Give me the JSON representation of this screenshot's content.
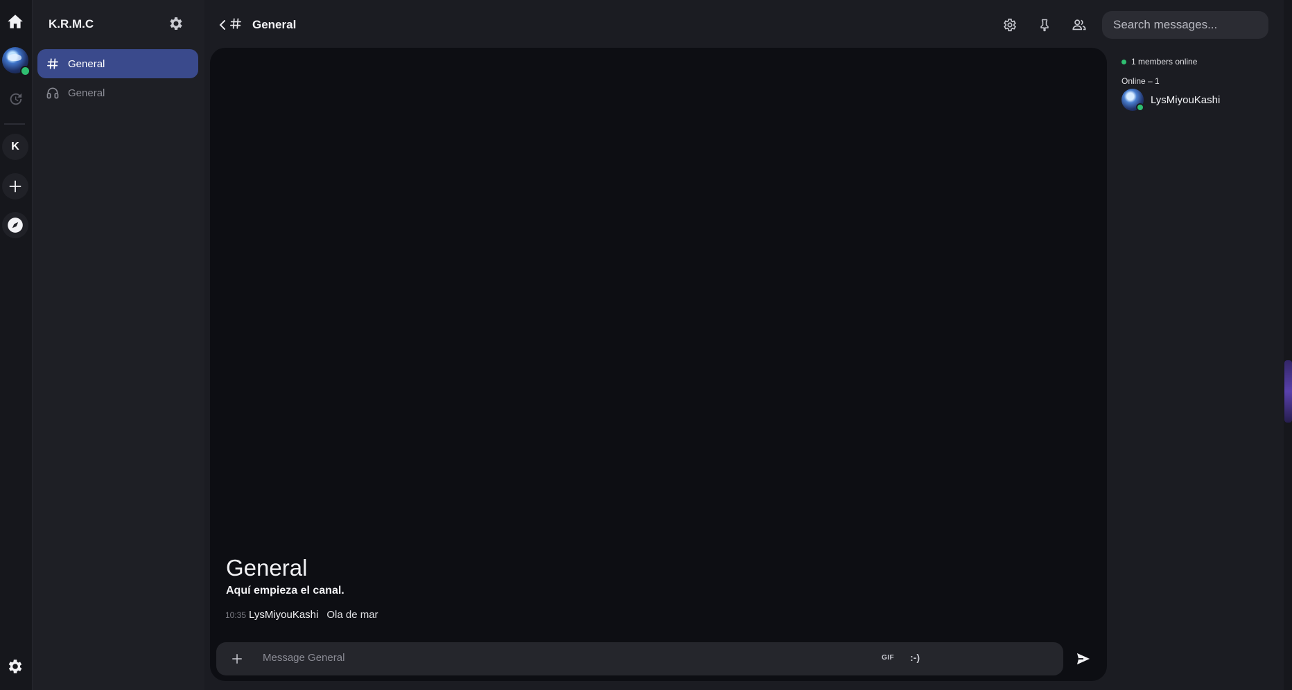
{
  "server": {
    "name": "K.R.M.C",
    "letter_icon": "K"
  },
  "rail": {
    "icons": [
      "home-icon",
      "user-avatar",
      "history-icon",
      "server-k",
      "add-server-icon",
      "explore-compass-icon",
      "settings-gear-icon"
    ]
  },
  "channels": [
    {
      "label": "General",
      "type": "text",
      "active": true
    },
    {
      "label": "General",
      "type": "voice",
      "active": false
    }
  ],
  "topbar": {
    "channel_title": "General",
    "search_placeholder": "Search messages..."
  },
  "chat": {
    "intro_title": "General",
    "intro_subtitle": "Aquí empieza el canal.",
    "messages": [
      {
        "time": "10:35",
        "author": "LysMiyouKashi",
        "text": "Ola de mar"
      }
    ],
    "composer_placeholder": "Message General",
    "gif_label": "GIF",
    "emoji_label": ":-)"
  },
  "members": {
    "online_summary": "1 members online",
    "online_header": "Online – 1",
    "list": [
      {
        "name": "LysMiyouKashi",
        "status": "online"
      }
    ]
  },
  "colors": {
    "accent": "#3a4a8c",
    "online": "#2fbf71",
    "background": "#1b1c22",
    "chat_bg": "#0d0e13"
  }
}
